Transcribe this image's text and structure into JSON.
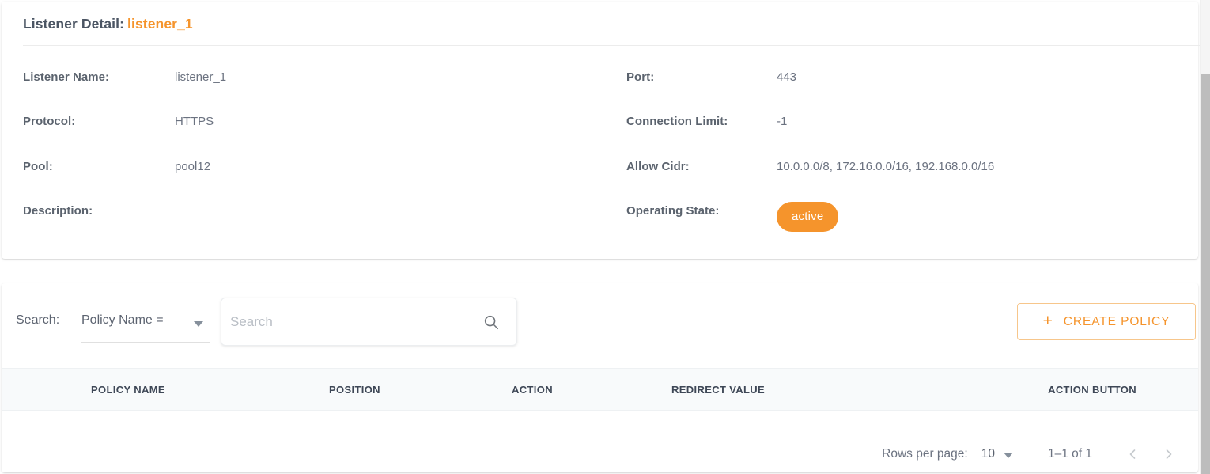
{
  "detail": {
    "title_prefix": "Listener Detail:",
    "title_value": "listener_1",
    "fields": {
      "listener_name": {
        "label": "Listener Name:",
        "value": "listener_1"
      },
      "protocol": {
        "label": "Protocol:",
        "value": "HTTPS"
      },
      "pool": {
        "label": "Pool:",
        "value": "pool12"
      },
      "description": {
        "label": "Description:",
        "value": ""
      },
      "port": {
        "label": "Port:",
        "value": "443"
      },
      "connection_limit": {
        "label": "Connection Limit:",
        "value": "-1"
      },
      "allow_cidr": {
        "label": "Allow Cidr:",
        "value": "10.0.0.0/8, 172.16.0.0/16, 192.168.0.0/16"
      },
      "operating_state": {
        "label": "Operating State:",
        "value": "active"
      }
    },
    "accent_color": "#f5942c",
    "badge_color": "#f5942c"
  },
  "toolbar": {
    "search_label": "Search:",
    "filter_selected": "Policy Name =",
    "search_placeholder": "Search",
    "search_value": "",
    "search_icon": "search-icon",
    "create_button_label": "CREATE POLICY",
    "create_button_icon": "plus-icon",
    "create_button_color": "#f5942c"
  },
  "table": {
    "columns": [
      "POLICY NAME",
      "POSITION",
      "ACTION",
      "REDIRECT VALUE",
      "ACTION BUTTON"
    ],
    "rows": []
  },
  "pagination": {
    "rows_per_page_label": "Rows per page:",
    "rows_per_page_value": "10",
    "range_text": "1–1 of 1",
    "prev_icon": "chevron-left-icon",
    "next_icon": "chevron-right-icon"
  }
}
